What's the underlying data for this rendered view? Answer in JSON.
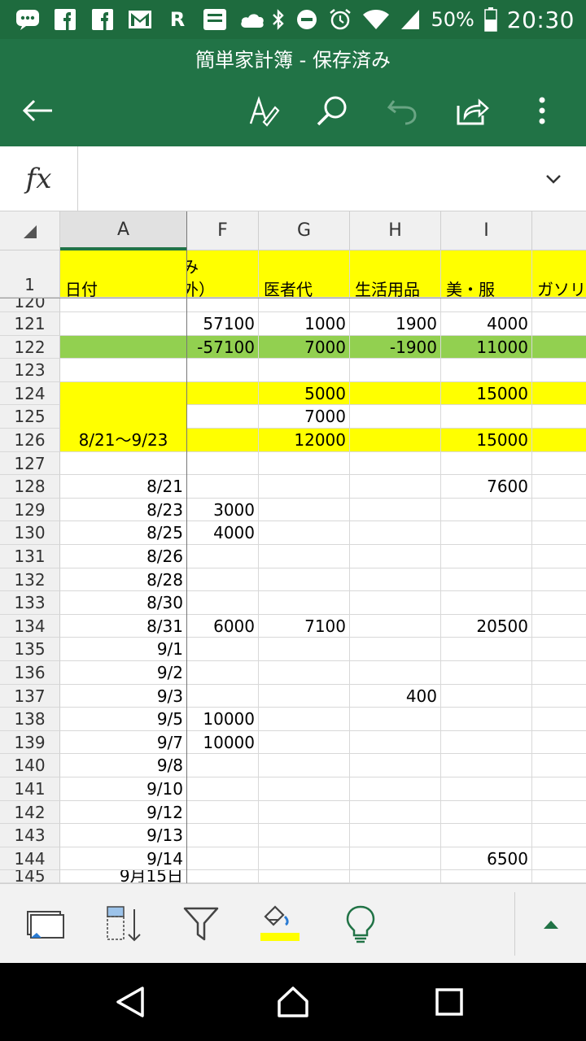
{
  "status_bar": {
    "battery": "50%",
    "time": "20:30",
    "left_icons": [
      "chat-icon",
      "facebook-icon",
      "facebook-icon",
      "gmail-icon",
      "rakuten-icon",
      "bank-icon",
      "cloud-icon"
    ],
    "right_icons": [
      "bluetooth-icon",
      "dnd-icon",
      "alarm-icon",
      "wifi-icon",
      "signal-icon",
      "battery-icon"
    ]
  },
  "app_bar": {
    "title": "簡単家計簿 - 保存済み",
    "icons": [
      "back-icon",
      "edit-icon",
      "search-icon",
      "undo-icon",
      "share-icon",
      "more-icon"
    ]
  },
  "formula_bar": {
    "fx_label": "fx",
    "value": ""
  },
  "columns": [
    "A",
    "F",
    "G",
    "H",
    "I"
  ],
  "header_row": {
    "row_label": "1",
    "A": "日付",
    "F_top": "み",
    "F": "外）",
    "G": "医者代",
    "H": "生活用品",
    "I": "美・服",
    "J": "ガソリ"
  },
  "rows": [
    {
      "n": "120",
      "A": "",
      "F": "",
      "G": "",
      "H": "",
      "I": ""
    },
    {
      "n": "121",
      "A": "",
      "F": "57100",
      "G": "1000",
      "H": "1900",
      "I": "4000"
    },
    {
      "n": "122",
      "A": "",
      "F": "-57100",
      "G": "7000",
      "H": "-1900",
      "I": "11000"
    },
    {
      "n": "123",
      "A": "",
      "F": "",
      "G": "",
      "H": "",
      "I": ""
    },
    {
      "n": "124",
      "A": "",
      "F": "",
      "G": "5000",
      "H": "",
      "I": "15000"
    },
    {
      "n": "125",
      "A": "",
      "F": "",
      "G": "7000",
      "H": "",
      "I": ""
    },
    {
      "n": "126",
      "A": "8/21～9/23",
      "F": "",
      "G": "12000",
      "H": "",
      "I": "15000"
    },
    {
      "n": "127",
      "A": "",
      "F": "",
      "G": "",
      "H": "",
      "I": ""
    },
    {
      "n": "128",
      "A": "8/21",
      "F": "",
      "G": "",
      "H": "",
      "I": "7600"
    },
    {
      "n": "129",
      "A": "8/23",
      "F": "3000",
      "G": "",
      "H": "",
      "I": ""
    },
    {
      "n": "130",
      "A": "8/25",
      "F": "4000",
      "G": "",
      "H": "",
      "I": ""
    },
    {
      "n": "131",
      "A": "8/26",
      "F": "",
      "G": "",
      "H": "",
      "I": ""
    },
    {
      "n": "132",
      "A": "8/28",
      "F": "",
      "G": "",
      "H": "",
      "I": ""
    },
    {
      "n": "133",
      "A": "8/30",
      "F": "",
      "G": "",
      "H": "",
      "I": ""
    },
    {
      "n": "134",
      "A": "8/31",
      "F": "6000",
      "G": "7100",
      "H": "",
      "I": "20500"
    },
    {
      "n": "135",
      "A": "9/1",
      "F": "",
      "G": "",
      "H": "",
      "I": ""
    },
    {
      "n": "136",
      "A": "9/2",
      "F": "",
      "G": "",
      "H": "",
      "I": ""
    },
    {
      "n": "137",
      "A": "9/3",
      "F": "",
      "G": "",
      "H": "400",
      "I": ""
    },
    {
      "n": "138",
      "A": "9/5",
      "F": "10000",
      "G": "",
      "H": "",
      "I": ""
    },
    {
      "n": "139",
      "A": "9/7",
      "F": "10000",
      "G": "",
      "H": "",
      "I": ""
    },
    {
      "n": "140",
      "A": "9/8",
      "F": "",
      "G": "",
      "H": "",
      "I": ""
    },
    {
      "n": "141",
      "A": "9/10",
      "F": "",
      "G": "",
      "H": "",
      "I": ""
    },
    {
      "n": "142",
      "A": "9/12",
      "F": "",
      "G": "",
      "H": "",
      "I": ""
    },
    {
      "n": "143",
      "A": "9/13",
      "F": "",
      "G": "",
      "H": "",
      "I": ""
    },
    {
      "n": "144",
      "A": "9/14",
      "F": "",
      "G": "",
      "H": "",
      "I": "6500"
    },
    {
      "n": "145",
      "A": "9月15日",
      "F": "",
      "G": "",
      "H": "",
      "I": ""
    }
  ],
  "fills": {
    "yellow": "#ffff00",
    "green": "#92d050",
    "accent": "#217346"
  },
  "toolbar_icons": [
    "sheets-icon",
    "sort-icon",
    "filter-icon",
    "fill-color-icon",
    "lightbulb-icon",
    "expand-up-icon"
  ],
  "nav_icons": [
    "back-nav-icon",
    "home-nav-icon",
    "recents-nav-icon"
  ]
}
